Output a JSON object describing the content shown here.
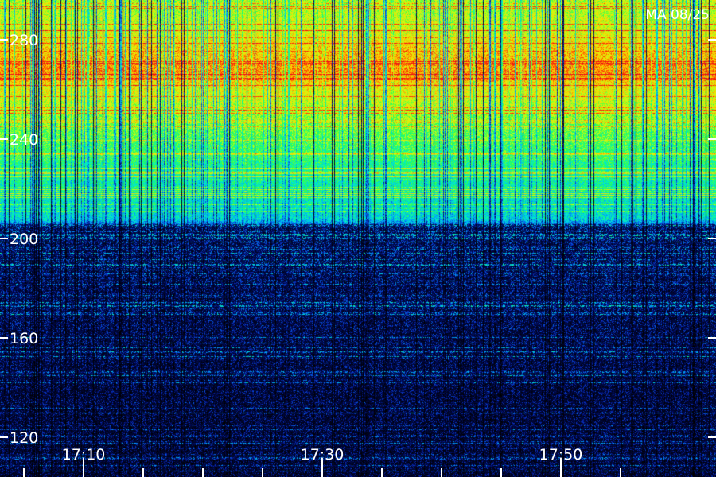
{
  "chart_data": {
    "type": "heatmap",
    "title": "",
    "corner_label": "MA 08/25",
    "xlabel": "",
    "ylabel": "",
    "x_tick_labels": [
      "17:10",
      "17:30",
      "17:50"
    ],
    "x_tick_values_min": [
      10,
      30,
      50
    ],
    "x_minor_tick_values_min": [
      5,
      10,
      15,
      20,
      25,
      30,
      35,
      40,
      45,
      50,
      55
    ],
    "xlim_min": [
      3,
      63
    ],
    "y_tick_labels": [
      "120",
      "160",
      "200",
      "240",
      "280"
    ],
    "y_tick_values": [
      120,
      160,
      200,
      240,
      280
    ],
    "ylim": [
      104,
      296
    ],
    "intensity_profile": [
      {
        "y": 104,
        "level": 0.12
      },
      {
        "y": 140,
        "level": 0.14
      },
      {
        "y": 180,
        "level": 0.18
      },
      {
        "y": 204,
        "level": 0.2
      },
      {
        "y": 208,
        "level": 0.42
      },
      {
        "y": 228,
        "level": 0.5
      },
      {
        "y": 244,
        "level": 0.6
      },
      {
        "y": 260,
        "level": 0.72
      },
      {
        "y": 268,
        "level": 0.82
      },
      {
        "y": 274,
        "level": 0.78
      },
      {
        "y": 286,
        "level": 0.68
      },
      {
        "y": 296,
        "level": 0.66
      }
    ],
    "colormap": [
      "#000000",
      "#000a5a",
      "#0a32c8",
      "#00a0ff",
      "#00f0c8",
      "#28ff50",
      "#c8ff14",
      "#ffd700",
      "#ff3c00",
      "#e6001e"
    ]
  }
}
